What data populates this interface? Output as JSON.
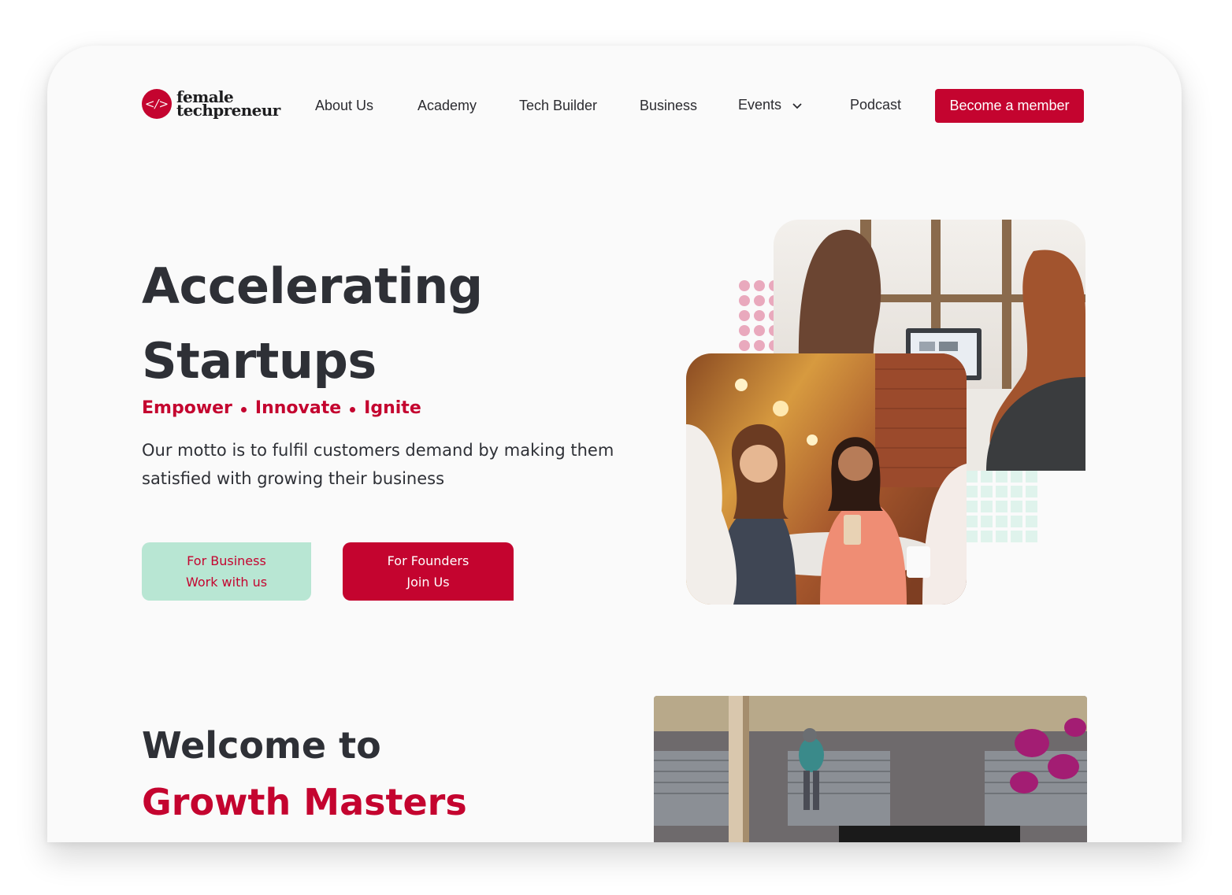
{
  "brand": {
    "name_line1": "female",
    "name_line2": "techpreneur",
    "mark_glyph": "</>",
    "color": "#c4042f"
  },
  "nav": {
    "items": [
      "About Us",
      "Academy",
      "Tech Builder",
      "Business",
      "Events",
      "Podcast"
    ],
    "events_icon": "chevron-down-icon",
    "cta_label": "Become a member"
  },
  "hero": {
    "title_line1": "Accelerating",
    "title_line2": "Startups",
    "tagline": [
      "Empower",
      "Innovate",
      "Ignite"
    ],
    "motto": "Our motto is to fulfil customers demand by making them satisfied with growing their business",
    "btn_business": {
      "line1": "For Business",
      "line2": "Work with us",
      "color": "#b8e6d3"
    },
    "btn_founders": {
      "line1": "For Founders",
      "line2": "Join Us",
      "color": "#c4042f"
    }
  },
  "welcome": {
    "line1": "Welcome to",
    "line2": "Growth Masters"
  },
  "colors": {
    "accent": "#c4042f",
    "mint": "#b8e6d3",
    "text": "#2e3036",
    "pink_dots": "#e9a9bd"
  }
}
